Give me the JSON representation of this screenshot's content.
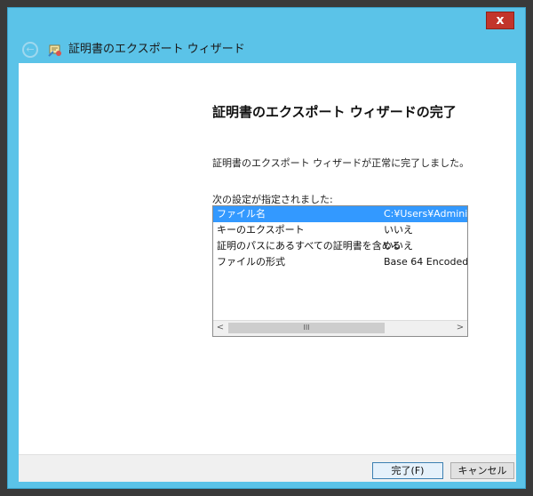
{
  "window": {
    "title": "証明書のエクスポート ウィザード",
    "close_label": "x"
  },
  "main": {
    "heading": "証明書のエクスポート ウィザードの完了",
    "description": "証明書のエクスポート ウィザードが正常に完了しました。",
    "list_label": "次の設定が指定されました:",
    "settings": [
      {
        "name": "ファイル名",
        "value": "C:¥Users¥Admini"
      },
      {
        "name": "キーのエクスポート",
        "value": "いいえ"
      },
      {
        "name": "証明のパスにあるすべての証明書を含める",
        "value": "いいえ"
      },
      {
        "name": "ファイルの形式",
        "value": "Base 64 Encoded"
      }
    ],
    "scrollbar": {
      "left": "<",
      "thumb": "III",
      "right": ">"
    }
  },
  "footer": {
    "finish_label": "完了(F)",
    "cancel_label": "キャンセル"
  },
  "icons": {
    "back": "back-arrow-icon",
    "wizard": "certificate-wizard-icon",
    "close": "close-icon"
  }
}
